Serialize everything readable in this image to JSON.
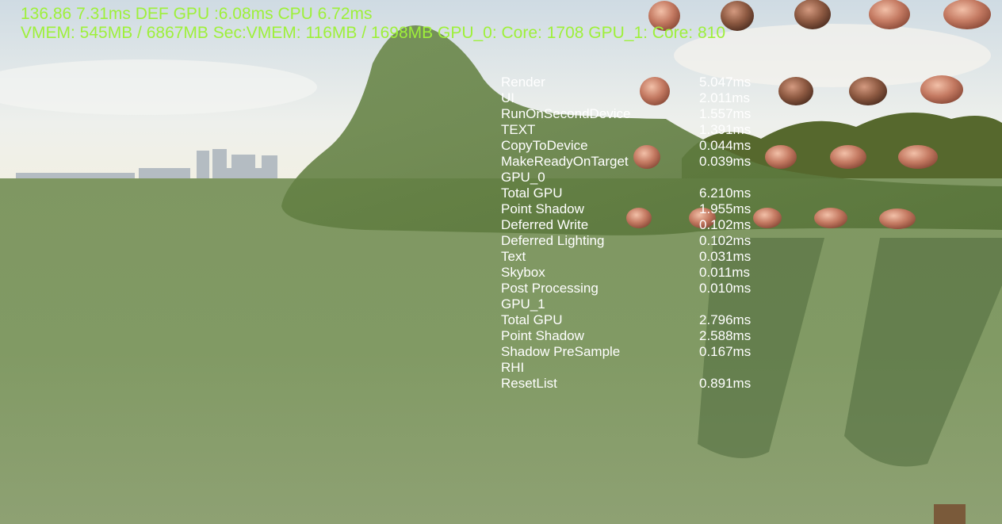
{
  "hud": {
    "line1": "136.86 7.31ms DEF GPU :6.08ms CPU 6.72ms",
    "line2": "VMEM: 545MB / 6867MB Sec:VMEM: 116MB / 1698MB GPU_0: Core: 1708 GPU_1: Core: 810"
  },
  "profiler": {
    "rows": [
      {
        "name": "Render",
        "time": "5.047ms"
      },
      {
        "name": "UI",
        "time": "2.011ms"
      },
      {
        "name": "RunOnSecondDevice",
        "time": "1.557ms"
      },
      {
        "name": "TEXT",
        "time": "1.391ms"
      },
      {
        "name": "CopyToDevice",
        "time": "0.044ms"
      },
      {
        "name": "MakeReadyOnTarget",
        "time": "0.039ms"
      },
      {
        "name": "GPU_0",
        "time": ""
      },
      {
        "name": "Total GPU",
        "time": "6.210ms"
      },
      {
        "name": "Point Shadow",
        "time": "1.955ms"
      },
      {
        "name": "Deferred Write",
        "time": "0.102ms"
      },
      {
        "name": "Deferred Lighting",
        "time": "0.102ms"
      },
      {
        "name": "Text",
        "time": "0.031ms"
      },
      {
        "name": "Skybox",
        "time": "0.011ms"
      },
      {
        "name": "Post Processing",
        "time": "0.010ms"
      },
      {
        "name": "GPU_1",
        "time": ""
      },
      {
        "name": "Total GPU",
        "time": "2.796ms"
      },
      {
        "name": "Point Shadow",
        "time": "2.588ms"
      },
      {
        "name": "Shadow PreSample",
        "time": "0.167ms"
      },
      {
        "name": "RHI",
        "time": ""
      },
      {
        "name": "ResetList",
        "time": "0.891ms"
      }
    ]
  },
  "colors": {
    "hud_text": "#9ef03a",
    "profiler_text": "#ffffff",
    "sky_top": "#d8e2e8",
    "grass": "#6f8550",
    "brick": "#b87060"
  }
}
